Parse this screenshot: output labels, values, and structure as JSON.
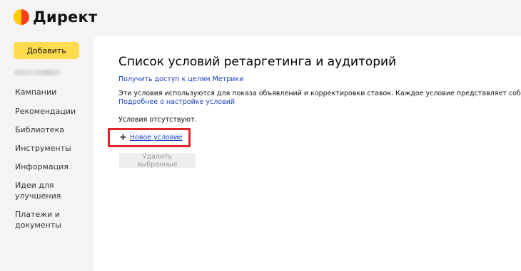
{
  "brand": {
    "name": "Директ"
  },
  "sidebar": {
    "add_button": "Добавить",
    "items": [
      {
        "label": "Кампании"
      },
      {
        "label": "Рекомендации"
      },
      {
        "label": "Библиотека"
      },
      {
        "label": "Инструменты"
      },
      {
        "label": "Информация"
      },
      {
        "label": "Идеи для улучшения"
      },
      {
        "label": "Платежи и документы"
      }
    ]
  },
  "main": {
    "title": "Список условий ретаргетинга и аудиторий",
    "metrika_link": "Получить доступ к целям Метрики",
    "description": "Эти условия используются для показа объявлений и корректировки ставок. Каждое условие представляет собой комбинацию",
    "setup_link": "Подробнее о настройке условий",
    "empty_text": "Условия отсутствуют.",
    "new_condition": "Новое условие",
    "delete_button": "Удалить выбранные"
  },
  "colors": {
    "accent_button": "#ffdb4d",
    "link": "#1a3dc1",
    "highlight": "#e0262b",
    "logo_red": "#fc3f1d",
    "logo_yellow": "#ffcc00"
  }
}
